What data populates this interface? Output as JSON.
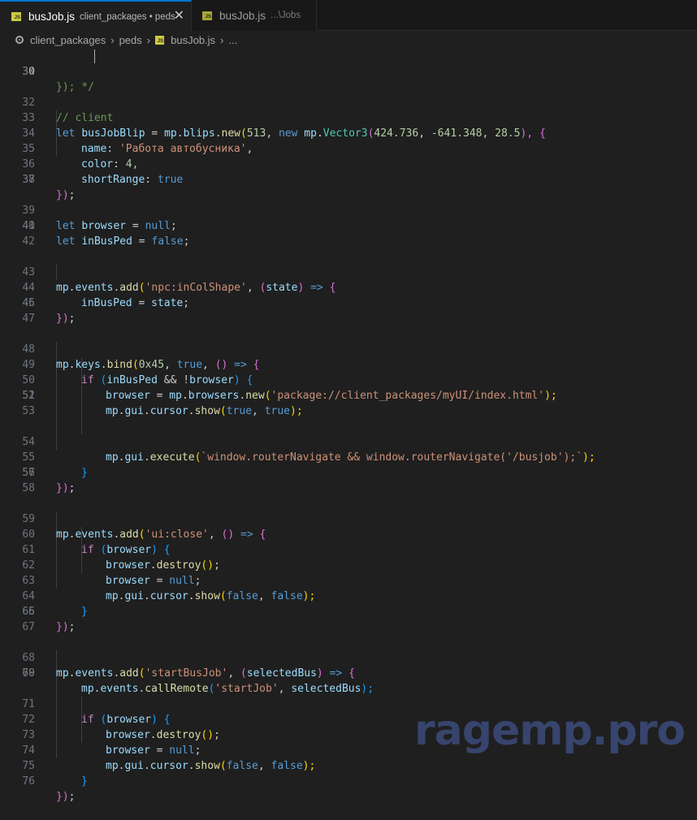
{
  "tabs": [
    {
      "name": "busJob.js",
      "description": "client_packages • peds",
      "active": true,
      "icon": "js-file-icon"
    },
    {
      "name": "busJob.js",
      "description": "...\\Jobs",
      "active": false,
      "icon": "js-file-icon"
    }
  ],
  "close_glyph": "✕",
  "js_badge": "JS",
  "breadcrumb": {
    "items": [
      "client_packages",
      "peds",
      "busJob.js",
      "..."
    ],
    "separator": "›"
  },
  "editor": {
    "cursor_line": 30,
    "lines": [
      {
        "n": "30"
      },
      {
        "n": "31"
      },
      {
        "n": "32"
      },
      {
        "n": "33"
      },
      {
        "n": "34"
      },
      {
        "n": "35"
      },
      {
        "n": "36"
      },
      {
        "n": "37"
      },
      {
        "n": "38"
      },
      {
        "n": "39"
      },
      {
        "n": "40"
      },
      {
        "n": "41"
      },
      {
        "n": "42"
      },
      {
        "n": "43"
      },
      {
        "n": "44"
      },
      {
        "n": "45"
      },
      {
        "n": "46"
      },
      {
        "n": "47"
      },
      {
        "n": "48"
      },
      {
        "n": "49"
      },
      {
        "n": "50"
      },
      {
        "n": "51"
      },
      {
        "n": "52"
      },
      {
        "n": "53"
      },
      {
        "n": "54"
      },
      {
        "n": "55"
      },
      {
        "n": "56"
      },
      {
        "n": "57"
      },
      {
        "n": "58"
      },
      {
        "n": "59"
      },
      {
        "n": "60"
      },
      {
        "n": "61"
      },
      {
        "n": "62"
      },
      {
        "n": "63"
      },
      {
        "n": "64"
      },
      {
        "n": "65"
      },
      {
        "n": "66"
      },
      {
        "n": "67"
      },
      {
        "n": "68"
      },
      {
        "n": "69"
      },
      {
        "n": "70"
      },
      {
        "n": "71"
      },
      {
        "n": "72"
      },
      {
        "n": "73"
      },
      {
        "n": "74"
      },
      {
        "n": "75"
      },
      {
        "n": "76"
      }
    ],
    "t": {
      "l30": "}); */",
      "l32": "// client",
      "l33": [
        "let",
        "busJobBlip",
        " = ",
        "mp",
        ".",
        "blips",
        ".",
        "new",
        "(",
        "513",
        ", ",
        "new",
        "mp",
        ".",
        "Vector3",
        "(",
        "424.736",
        ", ",
        "-641.348",
        ", ",
        "28.5",
        "), ",
        "{"
      ],
      "l34": [
        "name",
        ": ",
        "'Работа автобусника'",
        ","
      ],
      "l35": [
        "color",
        ": ",
        "4",
        ","
      ],
      "l36": [
        "shortRange",
        ": ",
        "true"
      ],
      "l37": [
        "})",
        ";"
      ],
      "l39": [
        "let",
        "browser",
        " = ",
        "null",
        ";"
      ],
      "l40": [
        "let",
        "inBusPed",
        " = ",
        "false",
        ";"
      ],
      "l43": [
        "mp",
        ".",
        "events",
        ".",
        "add",
        "(",
        "'npc:inColShape'",
        ", ",
        "(",
        "state",
        ")",
        " => ",
        "{"
      ],
      "l44": [
        "inBusPed",
        " = ",
        "state",
        ";"
      ],
      "l45": [
        "})",
        ";"
      ],
      "l48": [
        "mp",
        ".",
        "keys",
        ".",
        "bind",
        "(",
        "0x45",
        ", ",
        "true",
        ", ",
        "()",
        " => ",
        "{"
      ],
      "l49": [
        "if",
        " (",
        "inBusPed",
        " && !",
        "browser",
        ") ",
        "{"
      ],
      "l50": [
        "browser",
        " = ",
        "mp",
        ".",
        "browsers",
        ".",
        "new",
        "(",
        "'package://client_packages/myUI/index.html'",
        ");"
      ],
      "l51": [
        "mp",
        ".",
        "gui",
        ".",
        "cursor",
        ".",
        "show",
        "(",
        "true",
        ", ",
        "true",
        ");"
      ],
      "l54": [
        "mp",
        ".",
        "gui",
        ".",
        "execute",
        "(",
        "`window.routerNavigate && window.routerNavigate('/busjob');`",
        ");"
      ],
      "l55": [
        "}"
      ],
      "l56": [
        "})",
        ";"
      ],
      "l59": [
        "mp",
        ".",
        "events",
        ".",
        "add",
        "(",
        "'ui:close'",
        ", ",
        "()",
        " => ",
        "{"
      ],
      "l60": [
        "if",
        " (",
        "browser",
        ") ",
        "{"
      ],
      "l61": [
        "browser",
        ".",
        "destroy",
        "()",
        ";"
      ],
      "l62": [
        "browser",
        " = ",
        "null",
        ";"
      ],
      "l63": [
        "mp",
        ".",
        "gui",
        ".",
        "cursor",
        ".",
        "show",
        "(",
        "false",
        ", ",
        "false",
        ");"
      ],
      "l64": [
        "}"
      ],
      "l65": [
        "})",
        ";"
      ],
      "l68": [
        "mp",
        ".",
        "events",
        ".",
        "add",
        "(",
        "'startBusJob'",
        ", ",
        "(",
        "selectedBus",
        ")",
        " => ",
        "{"
      ],
      "l69": [
        "mp",
        ".",
        "events",
        ".",
        "callRemote",
        "(",
        "'startJob'",
        ", ",
        "selectedBus",
        ");"
      ],
      "l71": [
        "if",
        " (",
        "browser",
        ") ",
        "{"
      ],
      "l72": [
        "browser",
        ".",
        "destroy",
        "()",
        ";"
      ],
      "l73": [
        "browser",
        " = ",
        "null",
        ";"
      ],
      "l74": [
        "mp",
        ".",
        "gui",
        ".",
        "cursor",
        ".",
        "show",
        "(",
        "false",
        ", ",
        "false",
        ");"
      ],
      "l75": [
        "}"
      ],
      "l76": [
        "})",
        ";"
      ]
    }
  },
  "watermark": "ragemp.pro",
  "colors": {
    "background": "#1f1f1f",
    "tab_accent": "#0078d4",
    "keyword": "#569cd6",
    "control": "#c586c0",
    "variable": "#9cdcfe",
    "function": "#dcdcaa",
    "string": "#ce9178",
    "number": "#b5cea8",
    "comment": "#6a9955",
    "watermark": "#37446d"
  }
}
